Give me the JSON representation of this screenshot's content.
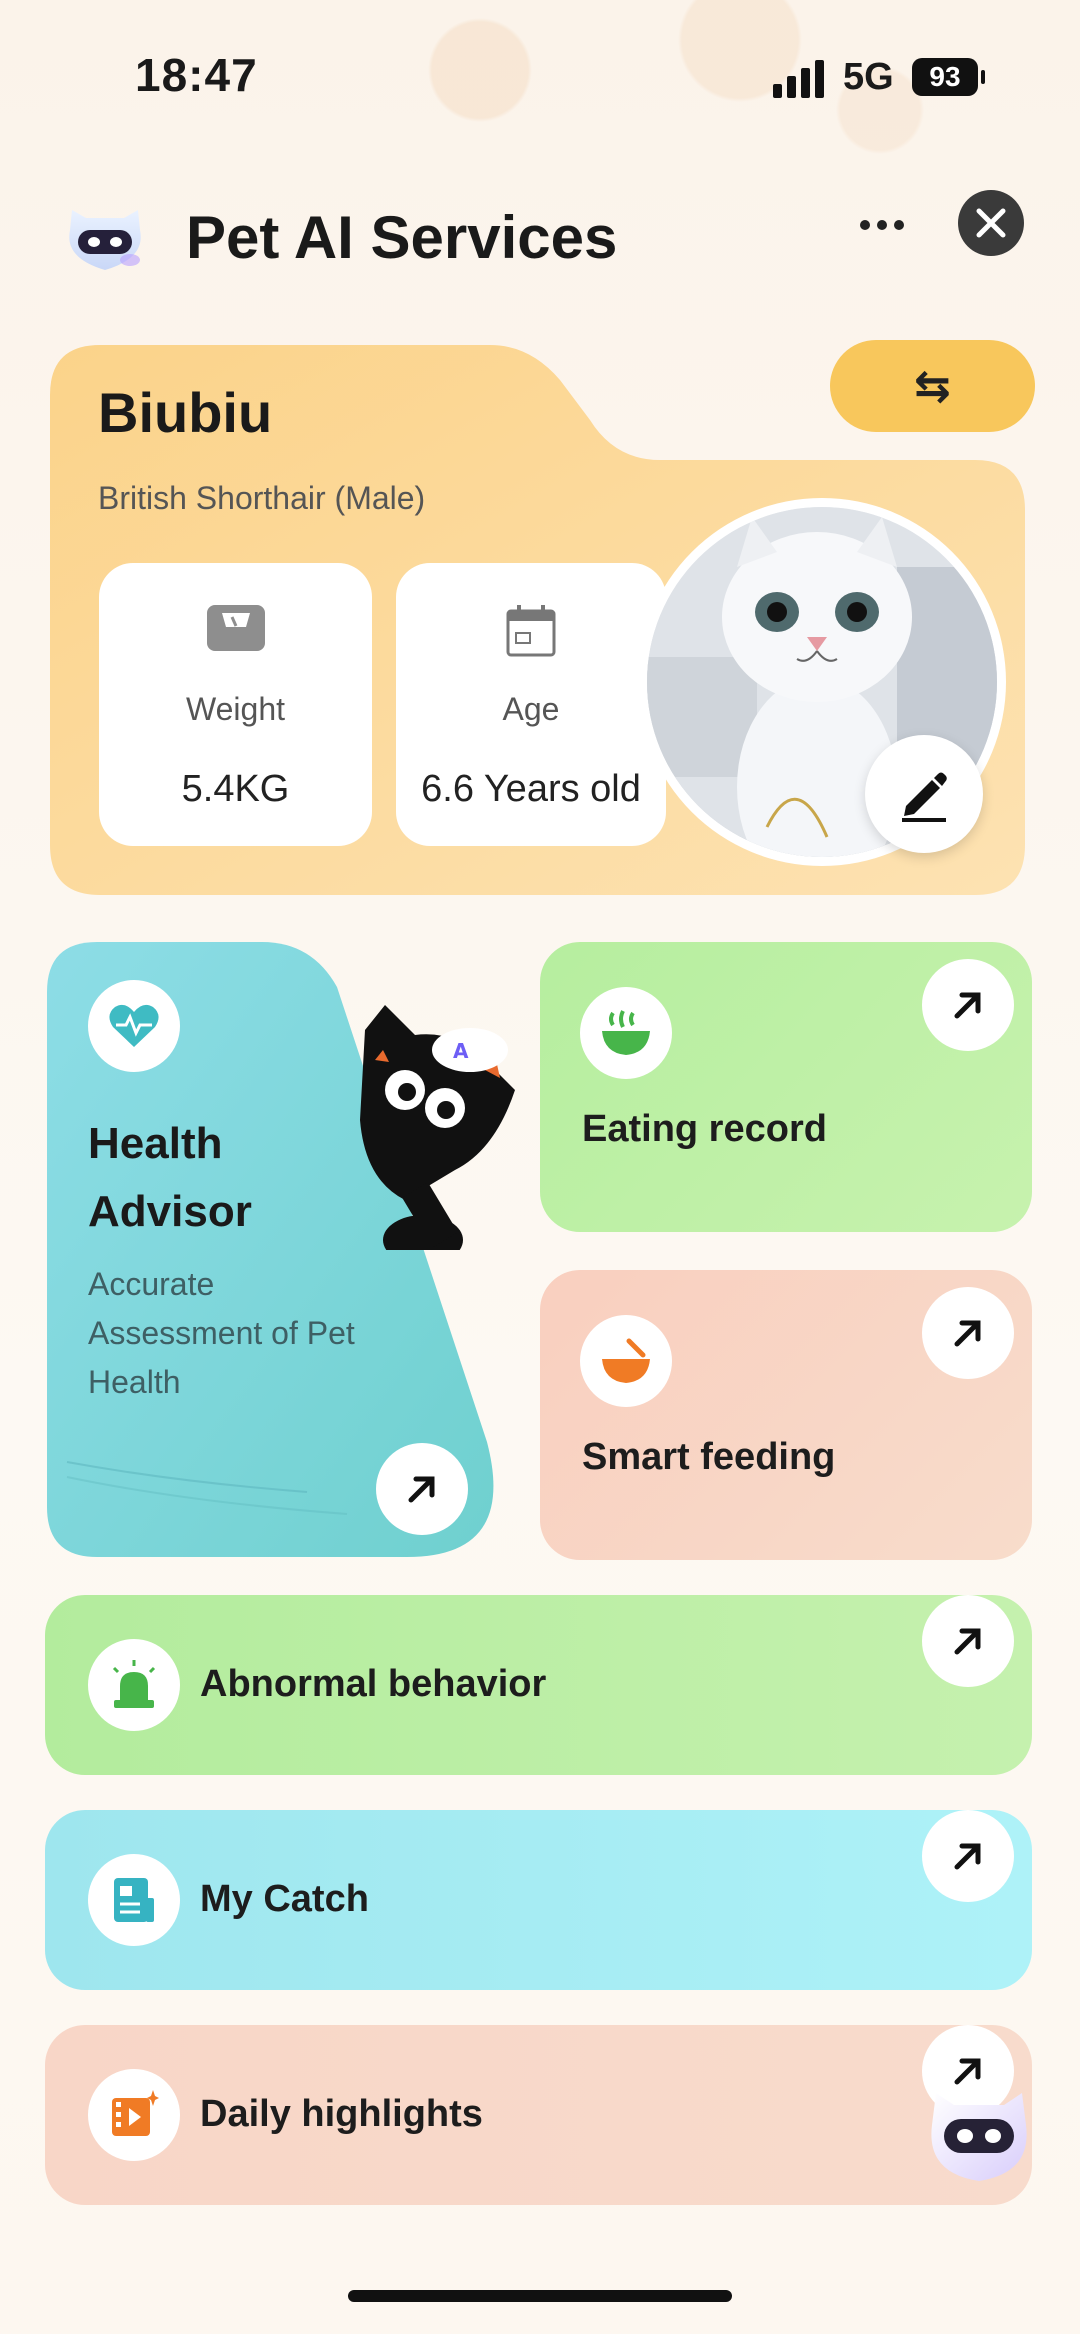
{
  "status_bar": {
    "time": "18:47",
    "network": "5G",
    "battery": "93"
  },
  "header": {
    "title": "Pet AI Services"
  },
  "pet": {
    "name": "Biubiu",
    "breed": "British Shorthair (Male)",
    "weight_label": "Weight",
    "weight_value": "5.4KG",
    "age_label": "Age",
    "age_value": "6.6 Years old",
    "switch_icon": "⇆"
  },
  "health": {
    "title": "Health Advisor",
    "description": "Accurate Assessment of Pet Health"
  },
  "tiles": {
    "eating": "Eating record",
    "feeding": "Smart feeding",
    "abnormal": "Abnormal behavior",
    "catch": "My Catch",
    "highlights": "Daily highlights"
  },
  "colors": {
    "pet_card": "#fbd893",
    "health_card": "#7fd9dd",
    "green_tile": "#b5ec9e",
    "peach_tile": "#f8d3c0",
    "cyan_tile": "#a8eef3"
  }
}
